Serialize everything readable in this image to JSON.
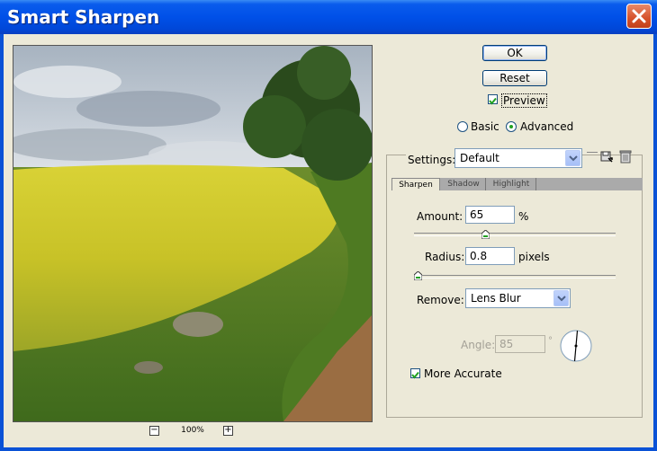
{
  "window": {
    "title": "Smart Sharpen"
  },
  "buttons": {
    "ok": "OK",
    "reset": "Reset"
  },
  "preview_option": {
    "label": "Preview",
    "checked": true
  },
  "mode": {
    "basic": "Basic",
    "advanced": "Advanced",
    "selected": "advanced"
  },
  "settings": {
    "label": "Settings:",
    "value": "Default"
  },
  "tabs": [
    {
      "label": "Sharpen",
      "active": true
    },
    {
      "label": "Shadow"
    },
    {
      "label": "Highlight"
    }
  ],
  "amount": {
    "label": "Amount:",
    "value": "65",
    "unit": "%",
    "slider_fraction": 0.35
  },
  "radius": {
    "label": "Radius:",
    "value": "0.8",
    "unit": "pixels",
    "slider_fraction": 0.0
  },
  "remove": {
    "label": "Remove:",
    "value": "Lens Blur"
  },
  "angle": {
    "label": "Angle:",
    "value": "85",
    "unit": "°"
  },
  "more_accurate": {
    "label": "More Accurate",
    "checked": true
  },
  "zoom": {
    "level": "100%",
    "minus": "−",
    "plus": "+"
  },
  "icons": [
    "close-icon",
    "save-settings-icon",
    "delete-settings-icon",
    "dropdown-arrow-icon",
    "angle-dial-icon",
    "zoom-out-icon",
    "zoom-in-icon"
  ],
  "colors": {
    "titlebar": "#0050e8",
    "dialog_bg": "#ece9d8",
    "close_button": "#d6512a"
  }
}
